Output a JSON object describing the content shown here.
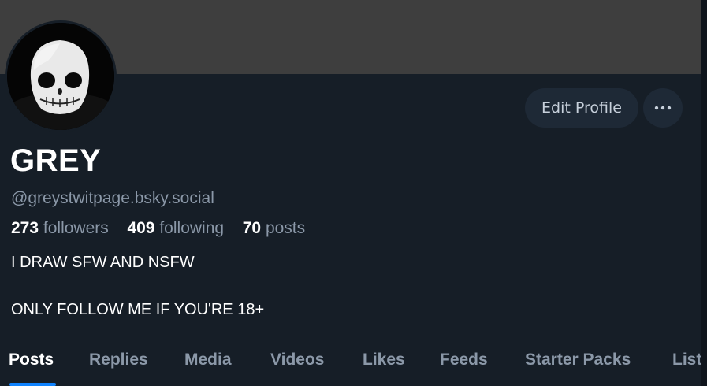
{
  "profile": {
    "display_name": "GREY",
    "handle": "@greystwitpage.bsky.social",
    "stats": {
      "followers_count": "273",
      "followers_label": "followers",
      "following_count": "409",
      "following_label": "following",
      "posts_count": "70",
      "posts_label": "posts"
    },
    "bio": [
      "I DRAW SFW AND NSFW",
      "ONLY FOLLOW ME IF YOU'RE 18+"
    ]
  },
  "actions": {
    "edit_profile_label": "Edit Profile",
    "more_icon": "ellipsis-icon"
  },
  "tabs": [
    "Posts",
    "Replies",
    "Media",
    "Videos",
    "Likes",
    "Feeds",
    "Starter Packs",
    "List"
  ],
  "active_tab": "Posts",
  "colors": {
    "background": "#161e27",
    "banner": "#3e3e3e",
    "button_bg": "#1e2936",
    "muted_text": "#8b98a8",
    "accent": "#1083fe"
  }
}
